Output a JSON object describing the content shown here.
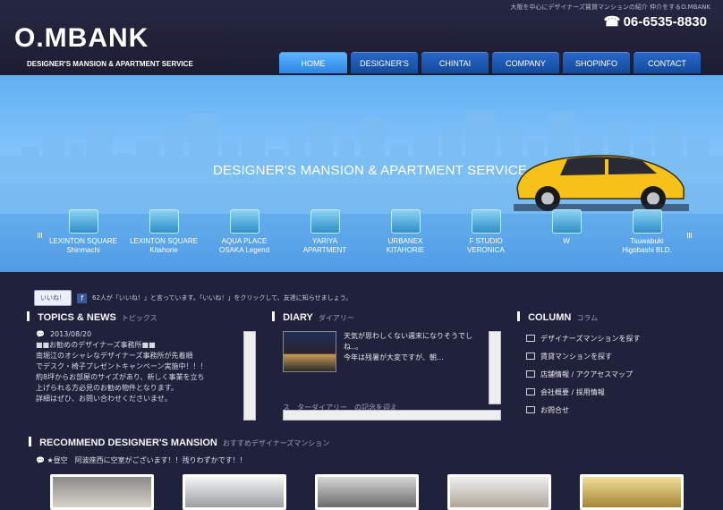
{
  "header": {
    "tagline": "大阪を中心にデザイナーズ賃貸マンションの紹介 仲介をするO.MBANK",
    "phone": "06-6535-8830",
    "phone_icon": "phone-icon",
    "logo": "O.MBANK",
    "logo_sub": "DESIGNER'S MANSION & APARTMENT SERVICE"
  },
  "nav": [
    {
      "label": "HOME"
    },
    {
      "label": "DESIGNER'S"
    },
    {
      "label": "CHINTAI"
    },
    {
      "label": "COMPANY"
    },
    {
      "label": "SHOPINFO"
    },
    {
      "label": "CONTACT"
    }
  ],
  "hero": {
    "title": "DESIGNER'S MANSION & APARTMENT SERVICE",
    "folders": [
      {
        "line1": "LEXINTON SQUARE",
        "line2": "Shinmachi"
      },
      {
        "line1": "LEXINTON SQUARE",
        "line2": "Kitahorie"
      },
      {
        "line1": "AQUA PLACE",
        "line2": "OSAKA Legend"
      },
      {
        "line1": "YARIYA",
        "line2": "APARTMENT"
      },
      {
        "line1": "URBANEX",
        "line2": "KITAHORIE"
      },
      {
        "line1": "F STUDIO",
        "line2": "VERONICA"
      },
      {
        "line1": "W",
        "line2": ""
      },
      {
        "line1": "Tsuwabuki",
        "line2": "Higobashi BLD."
      }
    ]
  },
  "like": {
    "button": "いいね！",
    "fb_icon": "facebook-icon",
    "text": "62人が「いいね！」と言っています。「いいね！」をクリックして、友達に知らせましょう。"
  },
  "topics": {
    "title": "TOPICS & NEWS",
    "sub": "トピックス",
    "date": "2013/08/20",
    "lines": [
      "■■お勧めのデザイナーズ事務所■■",
      "南堀江のオシャレなデザイナーズ事務所が先着順",
      "でデスク・椅子プレゼントキャンペーン実施中！！！",
      "約8坪からお部屋のサイズがあり、新しく事業を立ち",
      "上げられる方必見のお勧め物件となります。",
      "",
      "詳細はぜひ、お問い合わせくださいませ。"
    ]
  },
  "diary": {
    "title": "DIARY",
    "sub": "ダイアリー",
    "lines": [
      "天気が思わしくない週末になりそうでし",
      "ね..。",
      "",
      "今年は残暑が大変ですが、朝…"
    ],
    "hidden_text": "ス　ターダイアリー　の記念を迎え"
  },
  "column": {
    "title": "COLUMN",
    "sub": "コラム",
    "items": [
      "デザイナーズマンションを探す",
      "賃貸マンションを探す",
      "店舗情報 / アクアセスマップ",
      "会社概要 / 採用情報",
      "お問合せ"
    ]
  },
  "recommend": {
    "title": "RECOMMEND DESIGNER'S MANSION",
    "sub": "おすすめデザイナーズマンション",
    "notice": "★昼空　阿波座西に空室がございます！！残りわずかです！！"
  }
}
